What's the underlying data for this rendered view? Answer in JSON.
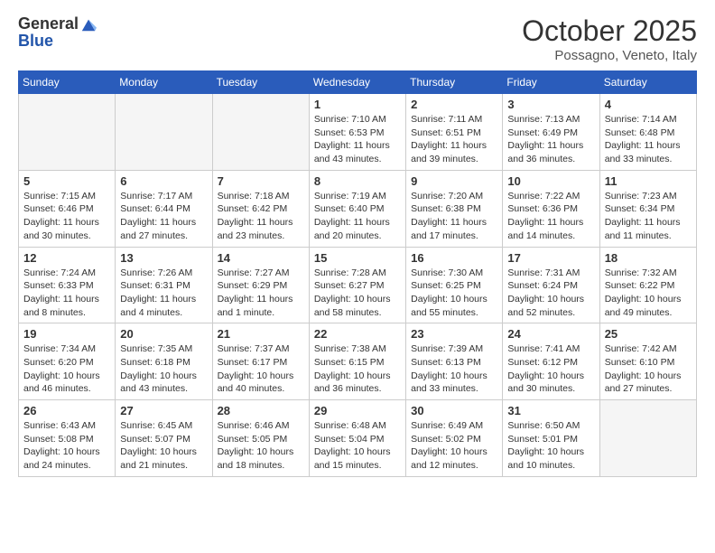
{
  "logo": {
    "general": "General",
    "blue": "Blue"
  },
  "header": {
    "month": "October 2025",
    "location": "Possagno, Veneto, Italy"
  },
  "days_of_week": [
    "Sunday",
    "Monday",
    "Tuesday",
    "Wednesday",
    "Thursday",
    "Friday",
    "Saturday"
  ],
  "weeks": [
    [
      {
        "day": "",
        "info": ""
      },
      {
        "day": "",
        "info": ""
      },
      {
        "day": "",
        "info": ""
      },
      {
        "day": "1",
        "info": "Sunrise: 7:10 AM\nSunset: 6:53 PM\nDaylight: 11 hours and 43 minutes."
      },
      {
        "day": "2",
        "info": "Sunrise: 7:11 AM\nSunset: 6:51 PM\nDaylight: 11 hours and 39 minutes."
      },
      {
        "day": "3",
        "info": "Sunrise: 7:13 AM\nSunset: 6:49 PM\nDaylight: 11 hours and 36 minutes."
      },
      {
        "day": "4",
        "info": "Sunrise: 7:14 AM\nSunset: 6:48 PM\nDaylight: 11 hours and 33 minutes."
      }
    ],
    [
      {
        "day": "5",
        "info": "Sunrise: 7:15 AM\nSunset: 6:46 PM\nDaylight: 11 hours and 30 minutes."
      },
      {
        "day": "6",
        "info": "Sunrise: 7:17 AM\nSunset: 6:44 PM\nDaylight: 11 hours and 27 minutes."
      },
      {
        "day": "7",
        "info": "Sunrise: 7:18 AM\nSunset: 6:42 PM\nDaylight: 11 hours and 23 minutes."
      },
      {
        "day": "8",
        "info": "Sunrise: 7:19 AM\nSunset: 6:40 PM\nDaylight: 11 hours and 20 minutes."
      },
      {
        "day": "9",
        "info": "Sunrise: 7:20 AM\nSunset: 6:38 PM\nDaylight: 11 hours and 17 minutes."
      },
      {
        "day": "10",
        "info": "Sunrise: 7:22 AM\nSunset: 6:36 PM\nDaylight: 11 hours and 14 minutes."
      },
      {
        "day": "11",
        "info": "Sunrise: 7:23 AM\nSunset: 6:34 PM\nDaylight: 11 hours and 11 minutes."
      }
    ],
    [
      {
        "day": "12",
        "info": "Sunrise: 7:24 AM\nSunset: 6:33 PM\nDaylight: 11 hours and 8 minutes."
      },
      {
        "day": "13",
        "info": "Sunrise: 7:26 AM\nSunset: 6:31 PM\nDaylight: 11 hours and 4 minutes."
      },
      {
        "day": "14",
        "info": "Sunrise: 7:27 AM\nSunset: 6:29 PM\nDaylight: 11 hours and 1 minute."
      },
      {
        "day": "15",
        "info": "Sunrise: 7:28 AM\nSunset: 6:27 PM\nDaylight: 10 hours and 58 minutes."
      },
      {
        "day": "16",
        "info": "Sunrise: 7:30 AM\nSunset: 6:25 PM\nDaylight: 10 hours and 55 minutes."
      },
      {
        "day": "17",
        "info": "Sunrise: 7:31 AM\nSunset: 6:24 PM\nDaylight: 10 hours and 52 minutes."
      },
      {
        "day": "18",
        "info": "Sunrise: 7:32 AM\nSunset: 6:22 PM\nDaylight: 10 hours and 49 minutes."
      }
    ],
    [
      {
        "day": "19",
        "info": "Sunrise: 7:34 AM\nSunset: 6:20 PM\nDaylight: 10 hours and 46 minutes."
      },
      {
        "day": "20",
        "info": "Sunrise: 7:35 AM\nSunset: 6:18 PM\nDaylight: 10 hours and 43 minutes."
      },
      {
        "day": "21",
        "info": "Sunrise: 7:37 AM\nSunset: 6:17 PM\nDaylight: 10 hours and 40 minutes."
      },
      {
        "day": "22",
        "info": "Sunrise: 7:38 AM\nSunset: 6:15 PM\nDaylight: 10 hours and 36 minutes."
      },
      {
        "day": "23",
        "info": "Sunrise: 7:39 AM\nSunset: 6:13 PM\nDaylight: 10 hours and 33 minutes."
      },
      {
        "day": "24",
        "info": "Sunrise: 7:41 AM\nSunset: 6:12 PM\nDaylight: 10 hours and 30 minutes."
      },
      {
        "day": "25",
        "info": "Sunrise: 7:42 AM\nSunset: 6:10 PM\nDaylight: 10 hours and 27 minutes."
      }
    ],
    [
      {
        "day": "26",
        "info": "Sunrise: 6:43 AM\nSunset: 5:08 PM\nDaylight: 10 hours and 24 minutes."
      },
      {
        "day": "27",
        "info": "Sunrise: 6:45 AM\nSunset: 5:07 PM\nDaylight: 10 hours and 21 minutes."
      },
      {
        "day": "28",
        "info": "Sunrise: 6:46 AM\nSunset: 5:05 PM\nDaylight: 10 hours and 18 minutes."
      },
      {
        "day": "29",
        "info": "Sunrise: 6:48 AM\nSunset: 5:04 PM\nDaylight: 10 hours and 15 minutes."
      },
      {
        "day": "30",
        "info": "Sunrise: 6:49 AM\nSunset: 5:02 PM\nDaylight: 10 hours and 12 minutes."
      },
      {
        "day": "31",
        "info": "Sunrise: 6:50 AM\nSunset: 5:01 PM\nDaylight: 10 hours and 10 minutes."
      },
      {
        "day": "",
        "info": ""
      }
    ]
  ]
}
